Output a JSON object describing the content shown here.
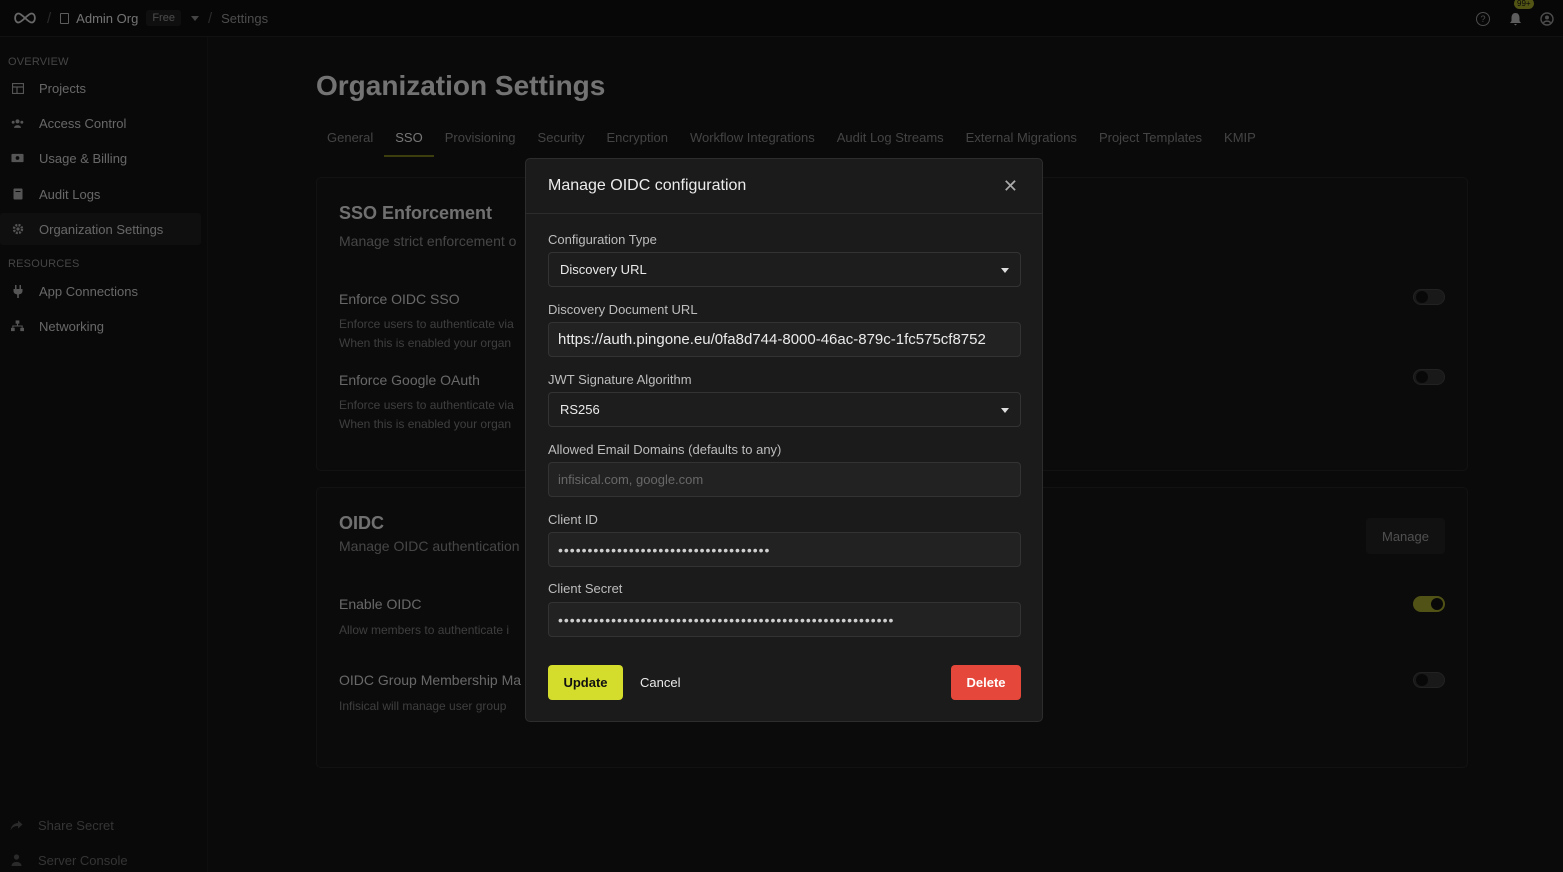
{
  "topbar": {
    "org_name": "Admin Org",
    "plan": "Free",
    "current_page": "Settings",
    "notification_count": "99+",
    "icons": [
      "infinity-logo-icon",
      "building-icon",
      "help-icon",
      "bell-icon",
      "user-circle-icon"
    ]
  },
  "sidebar": {
    "overview_title": "OVERVIEW",
    "resources_title": "RESOURCES",
    "items": [
      {
        "label": "Projects",
        "icon": "table-icon"
      },
      {
        "label": "Access Control",
        "icon": "users-icon"
      },
      {
        "label": "Usage & Billing",
        "icon": "money-icon"
      },
      {
        "label": "Audit Logs",
        "icon": "book-icon"
      },
      {
        "label": "Organization Settings",
        "icon": "gear-icon",
        "active": true
      },
      {
        "label": "App Connections",
        "icon": "plug-icon"
      },
      {
        "label": "Networking",
        "icon": "network-icon"
      }
    ],
    "footer": [
      {
        "label": "Share Secret",
        "icon": "share-icon"
      },
      {
        "label": "Server Console",
        "icon": "user-icon"
      }
    ]
  },
  "main": {
    "title": "Organization Settings",
    "tabs": [
      "General",
      "SSO",
      "Provisioning",
      "Security",
      "Encryption",
      "Workflow Integrations",
      "Audit Log Streams",
      "External Migrations",
      "Project Templates",
      "KMIP"
    ],
    "active_tab": "SSO",
    "sso_card": {
      "title": "SSO Enforcement",
      "subtitle": "Manage strict enforcement o",
      "rows": [
        {
          "title": "Enforce OIDC SSO",
          "desc1": "Enforce users to authenticate via",
          "desc2": "When this is enabled your organ",
          "enabled": false
        },
        {
          "title": "Enforce Google OAuth",
          "desc1": "Enforce users to authenticate via",
          "desc2": "When this is enabled your organ",
          "enabled": false
        }
      ]
    },
    "oidc_card": {
      "title": "OIDC",
      "subtitle": "Manage OIDC authentication",
      "manage_label": "Manage",
      "rows": [
        {
          "title": "Enable OIDC",
          "desc1": "Allow members to authenticate i",
          "enabled": true
        },
        {
          "title": "OIDC Group Membership Ma",
          "desc1": "Infisical will manage user group",
          "enabled": false
        }
      ]
    }
  },
  "modal": {
    "title": "Manage OIDC configuration",
    "config_type_label": "Configuration Type",
    "config_type_value": "Discovery URL",
    "discovery_label": "Discovery Document URL",
    "discovery_value": "https://auth.pingone.eu/0fa8d744-8000-46ac-879c-1fc575cf8752",
    "jwt_label": "JWT Signature Algorithm",
    "jwt_value": "RS256",
    "domains_label": "Allowed Email Domains (defaults to any)",
    "domains_placeholder": "infisical.com, google.com",
    "client_id_label": "Client ID",
    "client_id_value": "••••••••••••••••••••••••••••••••••••",
    "client_secret_label": "Client Secret",
    "client_secret_value": "•••••••••••••••••••••••••••••••••••••••••••••••••••••••••",
    "update_label": "Update",
    "cancel_label": "Cancel",
    "delete_label": "Delete"
  }
}
